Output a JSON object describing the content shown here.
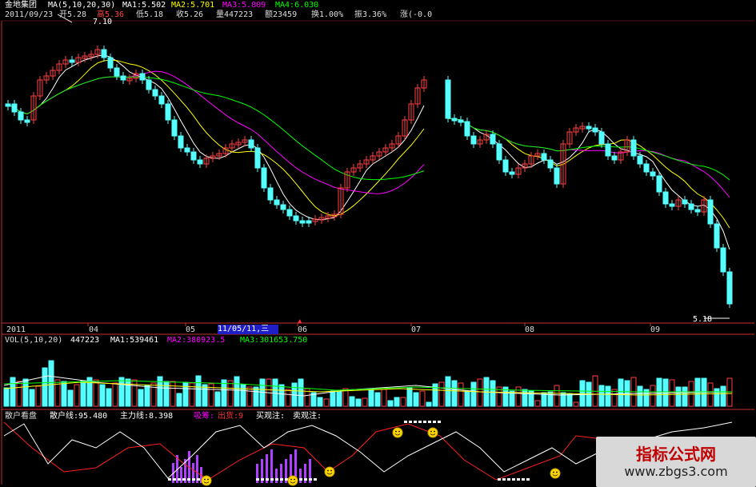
{
  "stock": {
    "name": "金地集团",
    "ma_params": "MA(5,10,20,30)",
    "ma1": "MA1:5.502",
    "ma2": "MA2:5.701",
    "ma3": "MA3:5.809",
    "ma4": "MA4:6.030"
  },
  "quote": {
    "date": "2011/09/23",
    "open": "开5.28",
    "high": "高5.36",
    "low": "低5.18",
    "close": "收5.26",
    "volume": "量447223",
    "amount": "额23459",
    "turnover": "换1.00%",
    "amplitude": "振3.36%",
    "change": "涨(-0.0"
  },
  "price_labels": {
    "peak": "7.10",
    "trough": "5.18"
  },
  "axis": {
    "months": [
      "2011",
      "04",
      "05",
      "06",
      "07",
      "08",
      "09"
    ],
    "selected_date": "11/05/11,三"
  },
  "vol_header": {
    "params": "VOL(5,10,20)",
    "volume": "447223",
    "ma1": "MA1:539461",
    "ma2": "MA2:380923.5",
    "ma3": "MA3:301653.750"
  },
  "ind_header": {
    "name": "散户看盘",
    "retail": "散户线:95.480",
    "main": "主力线:8.398",
    "wash": "吸筹:",
    "shipping": "出货:9",
    "buy": "买观注:",
    "sell": "卖观注:"
  },
  "watermark": {
    "title": "指标公式网",
    "url": "www.zbgs3.com"
  },
  "colors": {
    "up": "#ff4040",
    "down": "#54ffff",
    "ma1": "#ffffff",
    "ma2": "#ffff00",
    "ma3": "#ff00ff",
    "ma4": "#00ff00",
    "retail_line": "#ffffff",
    "main_line": "#ff2020",
    "bars": "#b040ff"
  }
}
